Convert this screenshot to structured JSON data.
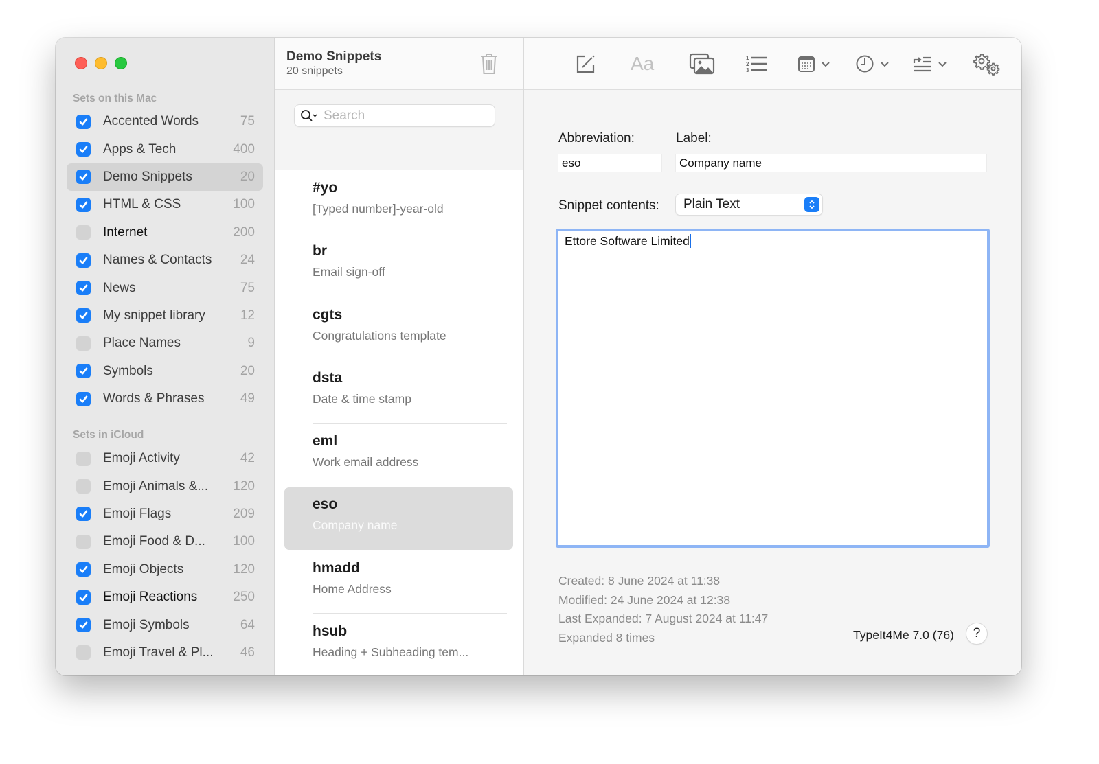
{
  "window": {
    "app_name": "TypeIt4Me"
  },
  "sidebar": {
    "sections": [
      {
        "title": "Sets on this Mac",
        "items": [
          {
            "label": "Accented Words",
            "count": "75",
            "checked": true,
            "selected": false,
            "dark": false
          },
          {
            "label": "Apps & Tech",
            "count": "400",
            "checked": true,
            "selected": false,
            "dark": false
          },
          {
            "label": "Demo Snippets",
            "count": "20",
            "checked": true,
            "selected": true,
            "dark": false
          },
          {
            "label": "HTML & CSS",
            "count": "100",
            "checked": true,
            "selected": false,
            "dark": false
          },
          {
            "label": "Internet",
            "count": "200",
            "checked": false,
            "selected": false,
            "dark": true
          },
          {
            "label": "Names & Contacts",
            "count": "24",
            "checked": true,
            "selected": false,
            "dark": false
          },
          {
            "label": "News",
            "count": "75",
            "checked": true,
            "selected": false,
            "dark": false
          },
          {
            "label": "My snippet library",
            "count": "12",
            "checked": true,
            "selected": false,
            "dark": false
          },
          {
            "label": "Place Names",
            "count": "9",
            "checked": false,
            "selected": false,
            "dark": false
          },
          {
            "label": "Symbols",
            "count": "20",
            "checked": true,
            "selected": false,
            "dark": false
          },
          {
            "label": "Words & Phrases",
            "count": "49",
            "checked": true,
            "selected": false,
            "dark": false
          }
        ]
      },
      {
        "title": "Sets in iCloud",
        "items": [
          {
            "label": "Emoji Activity",
            "count": "42",
            "checked": false,
            "selected": false,
            "dark": false
          },
          {
            "label": "Emoji Animals &...",
            "count": "120",
            "checked": false,
            "selected": false,
            "dark": false
          },
          {
            "label": "Emoji Flags",
            "count": "209",
            "checked": true,
            "selected": false,
            "dark": false
          },
          {
            "label": "Emoji Food & D...",
            "count": "100",
            "checked": false,
            "selected": false,
            "dark": false
          },
          {
            "label": "Emoji Objects",
            "count": "120",
            "checked": true,
            "selected": false,
            "dark": false
          },
          {
            "label": "Emoji Reactions",
            "count": "250",
            "checked": true,
            "selected": false,
            "dark": true
          },
          {
            "label": "Emoji Symbols",
            "count": "64",
            "checked": true,
            "selected": false,
            "dark": false
          },
          {
            "label": "Emoji Travel & Pl...",
            "count": "46",
            "checked": false,
            "selected": false,
            "dark": false
          }
        ]
      }
    ]
  },
  "snippet_list": {
    "title": "Demo Snippets",
    "subtitle": "20 snippets",
    "search_placeholder": "Search",
    "search_value": "",
    "items": [
      {
        "abbr": "#yo",
        "label": "[Typed number]-year-old",
        "selected": false
      },
      {
        "abbr": "br",
        "label": "Email sign-off",
        "selected": false
      },
      {
        "abbr": "cgts",
        "label": "Congratulations template",
        "selected": false
      },
      {
        "abbr": "dsta",
        "label": "Date & time stamp",
        "selected": false
      },
      {
        "abbr": "eml",
        "label": "Work email address",
        "selected": false
      },
      {
        "abbr": "eso",
        "label": "Company name",
        "selected": true
      },
      {
        "abbr": "hmadd",
        "label": "Home Address",
        "selected": false
      },
      {
        "abbr": "hsub",
        "label": "Heading + Subheading tem...",
        "selected": false
      }
    ]
  },
  "toolbar": {
    "buttons": [
      {
        "name": "new-snippet",
        "icon": "compose-icon"
      },
      {
        "name": "font",
        "icon": "font-icon",
        "glyph": "Aa"
      },
      {
        "name": "insert-image",
        "icon": "images-icon"
      },
      {
        "name": "numbered-list",
        "icon": "numbered-list-icon"
      },
      {
        "name": "date-menu",
        "icon": "calendar-icon"
      },
      {
        "name": "time-menu",
        "icon": "clock-icon"
      },
      {
        "name": "cursor-menu",
        "icon": "text-indent-icon"
      },
      {
        "name": "settings",
        "icon": "gears-icon"
      }
    ]
  },
  "editor": {
    "abbreviation_label": "Abbreviation:",
    "abbreviation_value": "eso",
    "label_label": "Label:",
    "label_value": "Company name",
    "contents_label": "Snippet contents:",
    "contents_type": "Plain Text",
    "contents_text": "Ettore Software Limited",
    "meta": {
      "created": "Created: 8 June 2024 at 11:38",
      "modified": "Modified: 24 June 2024 at 12:38",
      "last_expanded": "Last Expanded: 7 August 2024 at 11:47",
      "expanded_count": "Expanded 8 times"
    },
    "version": "TypeIt4Me 7.0 (76)",
    "help_glyph": "?"
  },
  "colors": {
    "accent": "#1a7ef8",
    "focus_ring": "#8eb5f5",
    "close": "#fe5f57",
    "minimize": "#febc2e",
    "maximize": "#28c840"
  }
}
